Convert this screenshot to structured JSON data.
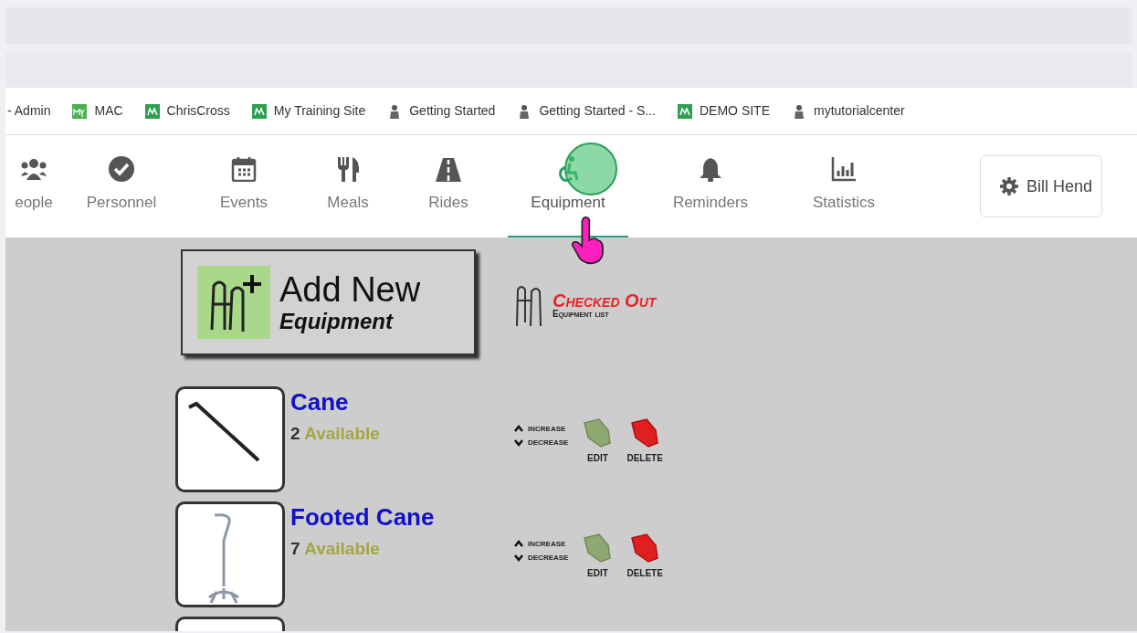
{
  "bookmarks": [
    {
      "label": "- Admin"
    },
    {
      "label": "MAC",
      "kind": "my"
    },
    {
      "label": "ChrisCross",
      "kind": "m"
    },
    {
      "label": "My Training Site",
      "kind": "m"
    },
    {
      "label": "Getting Started",
      "kind": "person"
    },
    {
      "label": "Getting Started - S...",
      "kind": "person"
    },
    {
      "label": "DEMO SITE",
      "kind": "m"
    },
    {
      "label": "mytutorialcenter",
      "kind": "person"
    }
  ],
  "nav": [
    {
      "label": "eople",
      "selected": false
    },
    {
      "label": "Personnel",
      "selected": false
    },
    {
      "label": "Events",
      "selected": false
    },
    {
      "label": "Meals",
      "selected": false
    },
    {
      "label": "Rides",
      "selected": false
    },
    {
      "label": "Equipment",
      "selected": true
    },
    {
      "label": "Reminders",
      "selected": false
    },
    {
      "label": "Statistics",
      "selected": false
    }
  ],
  "user_menu": {
    "label": "Bill Hend"
  },
  "add_button": {
    "line1": "Add New",
    "line2": "Equipment"
  },
  "checked_out": {
    "title": "Checked Out",
    "subtitle": "Equipment list"
  },
  "items": [
    {
      "name": "Cane",
      "count": "2",
      "available": "Available",
      "increase": "increase",
      "decrease": "decrease",
      "edit": "EDIT",
      "delete": "DELETE"
    },
    {
      "name": "Footed Cane",
      "count": "7",
      "available": "Available",
      "increase": "increase",
      "decrease": "decrease",
      "edit": "EDIT",
      "delete": "DELETE"
    }
  ]
}
